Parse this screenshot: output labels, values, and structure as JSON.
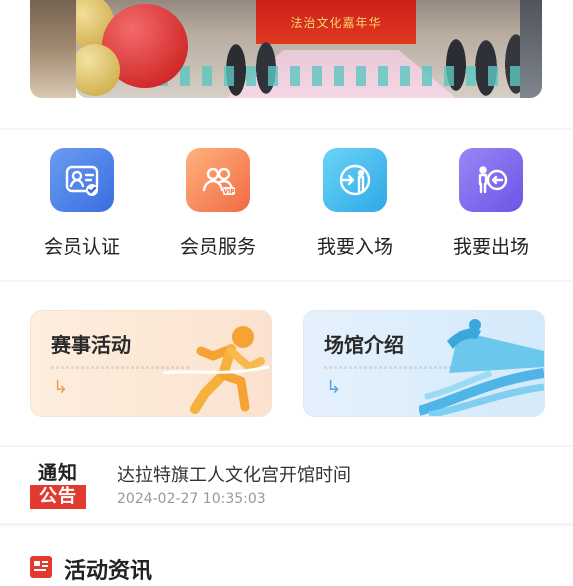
{
  "banner": {
    "stage_text": "法治文化嘉年华"
  },
  "quick_menu": [
    {
      "label": "会员认证",
      "icon": "member-verify-icon",
      "color": "#3a6ee0"
    },
    {
      "label": "会员服务",
      "icon": "member-service-icon",
      "color": "#f26a43"
    },
    {
      "label": "我要入场",
      "icon": "enter-venue-icon",
      "color": "#2fa8e6"
    },
    {
      "label": "我要出场",
      "icon": "exit-venue-icon",
      "color": "#6b55e6"
    }
  ],
  "cards": [
    {
      "title": "赛事活动",
      "icon": "runner-icon"
    },
    {
      "title": "场馆介绍",
      "icon": "track-icon"
    }
  ],
  "notice": {
    "badge_top": "通知",
    "badge_bottom": "公告",
    "title": "达拉特旗工人文化宫开馆时间",
    "time": "2024-02-27 10:35:03"
  },
  "section": {
    "title": "活动资讯"
  }
}
